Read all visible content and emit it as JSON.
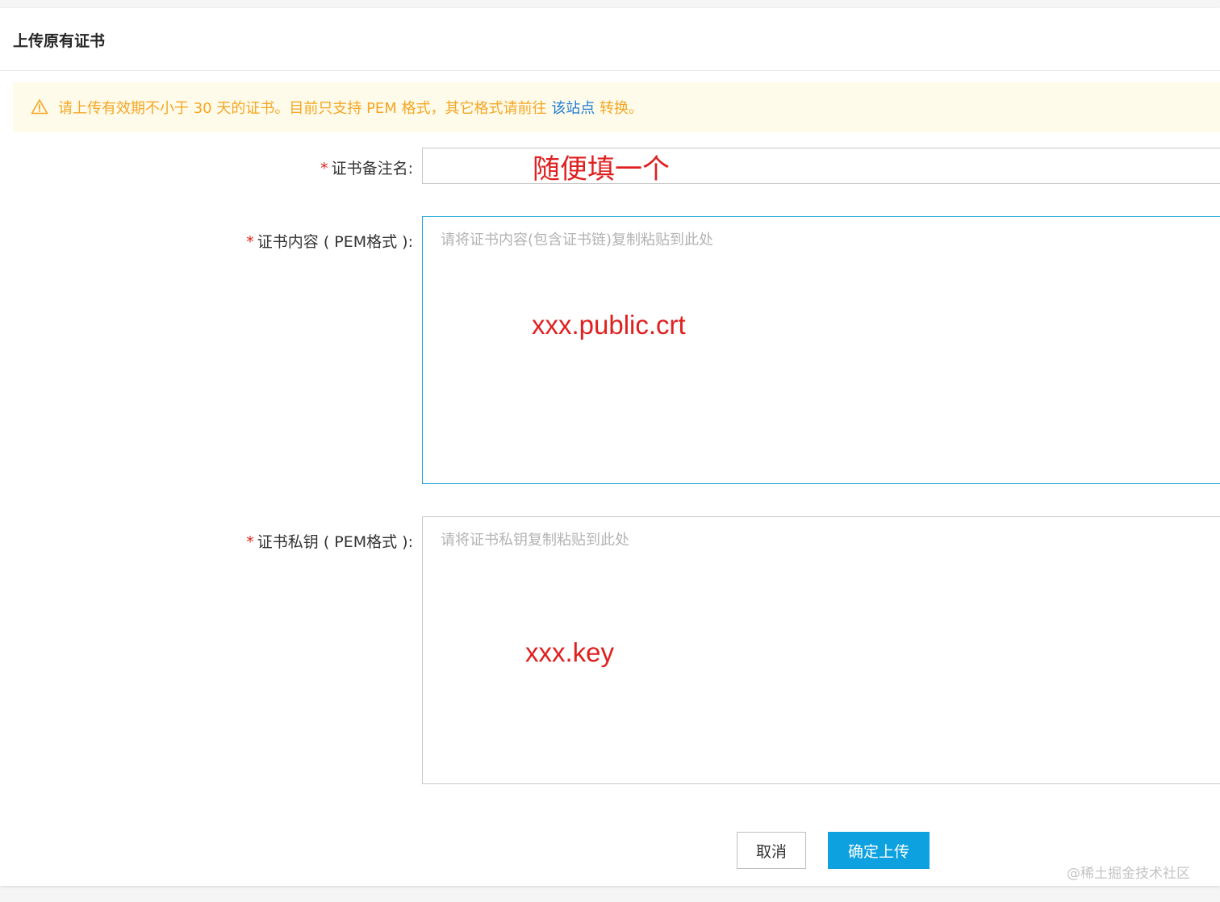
{
  "dialog": {
    "title": "上传原有证书"
  },
  "notice": {
    "icon": "warning-icon",
    "text_before": "请上传有效期不小于 30 天的证书。目前只支持 PEM 格式，其它格式请前往 ",
    "link_text": "该站点",
    "text_after": " 转换。",
    "color": "#f5a623",
    "link_color": "#1e7bd6"
  },
  "form": {
    "cert_name": {
      "required_mark": "*",
      "label": "证书备注名:",
      "value": "",
      "annotation": "随便填一个"
    },
    "cert_content": {
      "required_mark": "*",
      "label": "证书内容 ( PEM格式 ):",
      "placeholder": "请将证书内容(包含证书链)复制粘贴到此处",
      "annotation": "xxx.public.crt"
    },
    "private_key": {
      "required_mark": "*",
      "label": "证书私钥 ( PEM格式 ):",
      "placeholder": "请将证书私钥复制粘贴到此处",
      "annotation": "xxx.key"
    }
  },
  "footer": {
    "cancel_label": "取消",
    "confirm_label": "确定上传",
    "primary_color": "#0da1e0"
  },
  "watermark": "@稀土掘金技术社区"
}
